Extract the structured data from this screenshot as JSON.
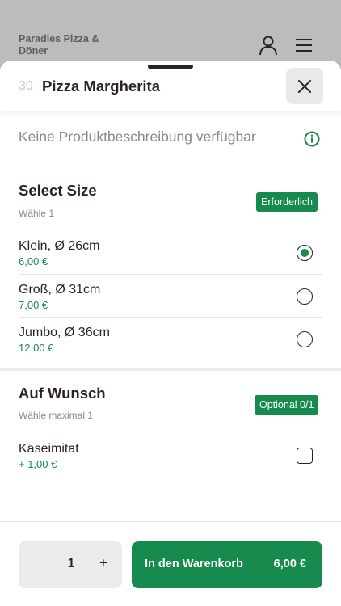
{
  "background": {
    "brand": "Paradies Pizza & Döner",
    "user_icon": "user-icon",
    "menu_icon": "hamburger-menu-icon"
  },
  "product": {
    "number": "30",
    "title": "Pizza Margherita",
    "description": "Keine Produktbeschreibung verfügbar",
    "close_icon": "close-icon",
    "info_icon": "info-icon"
  },
  "groups": [
    {
      "title": "Select Size",
      "subtitle": "Wähle 1",
      "badge": "Erforderlich",
      "type": "radio",
      "options": [
        {
          "name": "Klein, Ø 26cm",
          "price": "6,00 €",
          "selected": true
        },
        {
          "name": "Groß, Ø 31cm",
          "price": "7,00 €",
          "selected": false
        },
        {
          "name": "Jumbo, Ø 36cm",
          "price": "12,00 €",
          "selected": false
        }
      ]
    },
    {
      "title": "Auf Wunsch",
      "subtitle": "Wähle maximal 1",
      "badge": "Optional 0/1",
      "type": "checkbox",
      "options": [
        {
          "name": "Käseimitat",
          "price": "+ 1,00 €",
          "selected": false
        }
      ]
    }
  ],
  "footer": {
    "quantity": "1",
    "plus": "+",
    "cart_label": "In den Warenkorb",
    "cart_price": "6,00 €"
  },
  "colors": {
    "accent": "#178a4e",
    "text": "#2b2321",
    "muted": "#8a8a8a"
  }
}
